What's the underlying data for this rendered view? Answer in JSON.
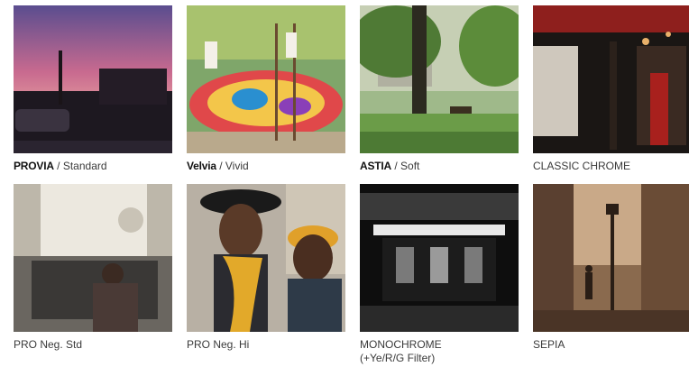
{
  "film_simulations": [
    {
      "brand": "PROVIA",
      "mode": "Standard"
    },
    {
      "brand": "Velvia",
      "mode": "Vivid"
    },
    {
      "brand": "ASTIA",
      "mode": "Soft"
    },
    {
      "label": "CLASSIC CHROME"
    },
    {
      "label": "PRO Neg. Std"
    },
    {
      "label": "PRO Neg. Hi"
    },
    {
      "label": "MONOCHROME",
      "label2": "(+Ye/R/G Filter)"
    },
    {
      "label": "SEPIA"
    }
  ],
  "separator": "/"
}
